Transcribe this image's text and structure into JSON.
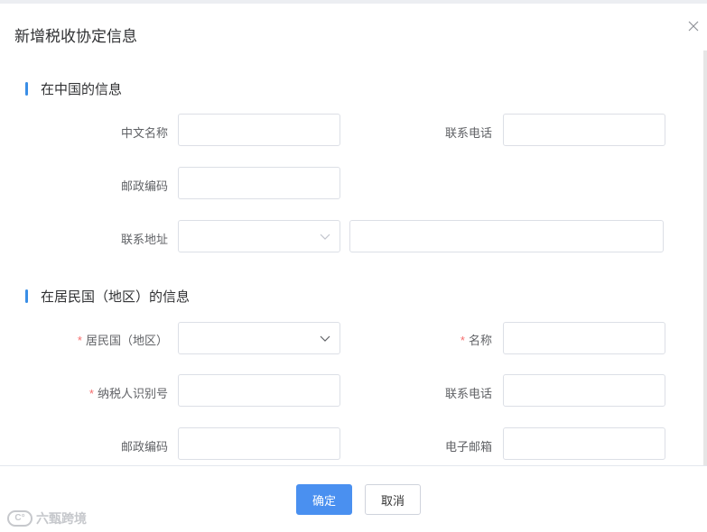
{
  "dialog": {
    "title": "新增税收协定信息",
    "close_icon": "close-icon"
  },
  "section_china": {
    "title": "在中国的信息",
    "fields": {
      "chinese_name_label": "中文名称",
      "phone_label": "联系电话",
      "postcode_label": "邮政编码",
      "address_label": "联系地址"
    }
  },
  "section_resident": {
    "title": "在居民国（地区）的信息",
    "fields": {
      "country_label": "居民国（地区）",
      "name_label": "名称",
      "taxpayer_id_label": "纳税人识别号",
      "phone_label": "联系电话",
      "postcode_label": "邮政编码",
      "email_label": "电子邮箱"
    },
    "required_mark": "*"
  },
  "footer": {
    "confirm_label": "确定",
    "cancel_label": "取消"
  },
  "watermark": {
    "logo_text": "C°",
    "text": "六甄跨境"
  },
  "colors": {
    "accent": "#4a90f0",
    "section_bar": "#3a8ee6",
    "required": "#f56c6c"
  }
}
